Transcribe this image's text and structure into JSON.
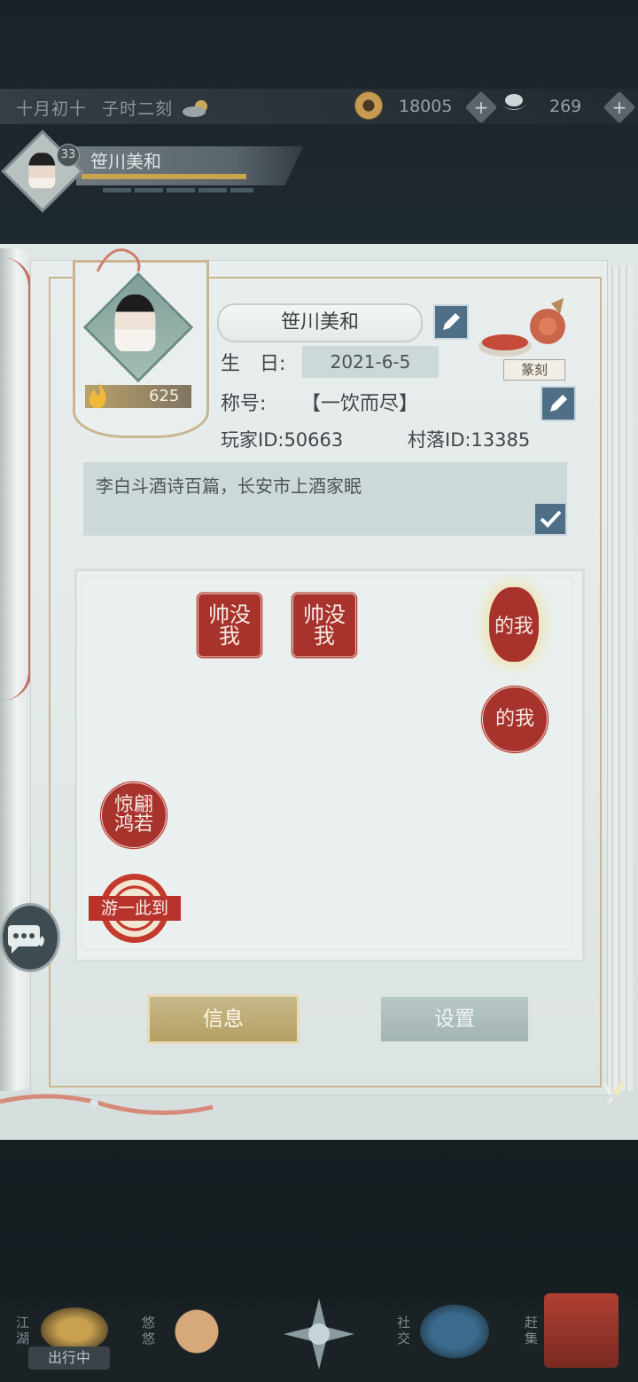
{
  "status_bar": {
    "date": "十月初十",
    "time": "子时二刻",
    "weather_icon": "cloudy-sun-icon",
    "copper_coins": "18005",
    "silver_ingots": "269",
    "plus_symbol": "+"
  },
  "player_plate": {
    "level": "33",
    "name": "笹川美和"
  },
  "profile": {
    "popularity": "625",
    "name": "笹川美和",
    "birthday_label": "生　日:",
    "birthday_value": "2021-6-5",
    "title_label": "称号:",
    "title_value": "【一饮而尽】",
    "player_id": "玩家ID:50663",
    "village_id": "村落ID:13385",
    "signature": "李白斗酒诗百篇，长安市上酒家眠",
    "carving_label": "篆刻"
  },
  "seals": [
    {
      "text": "帅没\n我",
      "shape": "square"
    },
    {
      "text": "帅没\n我",
      "shape": "square"
    },
    {
      "text": "的我",
      "shape": "oval"
    },
    {
      "text": "的我",
      "shape": "circle"
    },
    {
      "text": "惊翩\n鸿若",
      "shape": "circle"
    },
    {
      "text": "游一此到",
      "shape": "ring"
    }
  ],
  "tabs": {
    "info": "信息",
    "settings": "设置"
  },
  "bottom_nav": {
    "jianghu": "江湖",
    "outing": "出行中",
    "youyou": "悠悠",
    "social": "社交",
    "fair": "赶集"
  },
  "colors": {
    "seal_red": "#a8322c",
    "accent_gold": "#c9b68f",
    "edit_blue": "#4f6f87"
  }
}
